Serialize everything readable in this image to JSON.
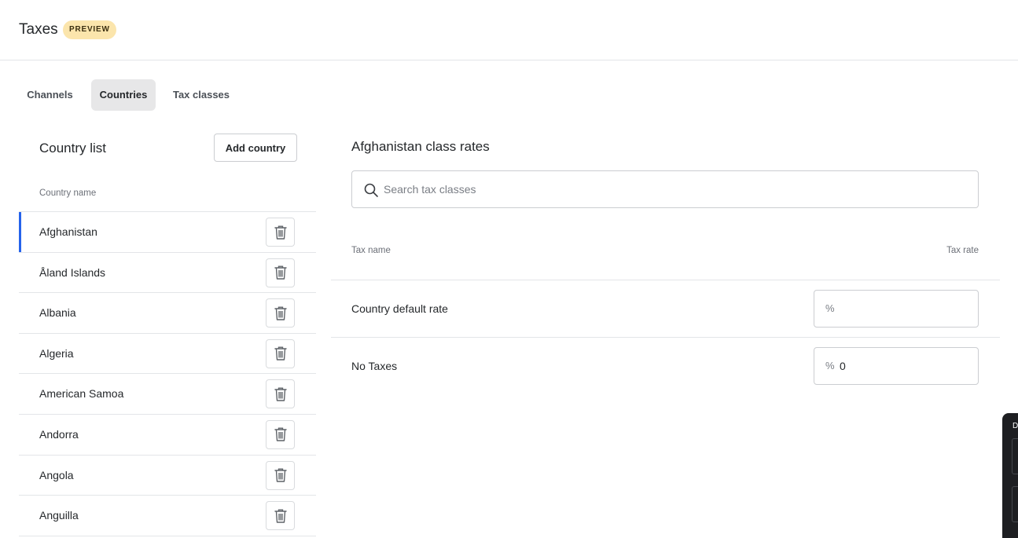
{
  "header": {
    "title": "Taxes",
    "badge": "PREVIEW"
  },
  "tabs": [
    {
      "label": "Channels"
    },
    {
      "label": "Countries"
    },
    {
      "label": "Tax classes"
    }
  ],
  "active_tab": "Countries",
  "country_list": {
    "title": "Country list",
    "add_button": "Add country",
    "column_header": "Country name",
    "selected": "Afghanistan",
    "countries": [
      {
        "name": "Afghanistan"
      },
      {
        "name": "Åland Islands"
      },
      {
        "name": "Albania"
      },
      {
        "name": "Algeria"
      },
      {
        "name": "American Samoa"
      },
      {
        "name": "Andorra"
      },
      {
        "name": "Angola"
      },
      {
        "name": "Anguilla"
      }
    ]
  },
  "class_rates": {
    "title": "Afghanistan class rates",
    "search_placeholder": "Search tax classes",
    "col_name": "Tax name",
    "col_rate": "Tax rate",
    "rows": [
      {
        "name": "Country default rate",
        "unit": "%",
        "value": ""
      },
      {
        "name": "No Taxes",
        "unit": "%",
        "value": "0"
      }
    ]
  },
  "dev_panel": {
    "letter": "D"
  },
  "colors": {
    "accent": "#2563eb",
    "badge_bg": "#fbe5ac",
    "active_tab_bg": "#e7e7e8"
  },
  "icons": {
    "search": "search-icon",
    "delete": "trash-icon"
  }
}
